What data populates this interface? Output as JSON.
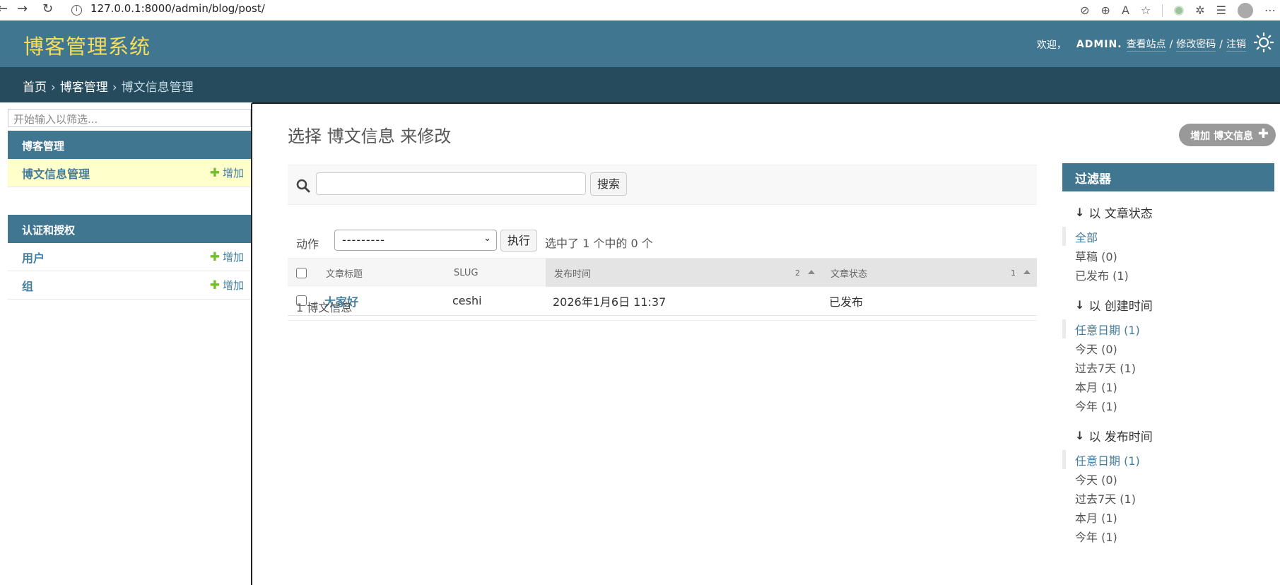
{
  "browser": {
    "url": "127.0.0.1:8000/admin/blog/post/"
  },
  "header": {
    "brand": "博客管理系统",
    "welcome": "欢迎，",
    "username": "ADMIN.",
    "view_site": "查看站点",
    "change_password": "修改密码",
    "logout": "注销",
    "separator": "/"
  },
  "breadcrumbs": {
    "home": "首页",
    "app": "博客管理",
    "current": "博文信息管理",
    "sep": "›"
  },
  "sidebar": {
    "filter_placeholder": "开始输入以筛选...",
    "modules": [
      {
        "caption": "博客管理",
        "items": [
          {
            "label": "博文信息管理",
            "add": "增加",
            "current": true
          }
        ]
      },
      {
        "caption": "认证和授权",
        "items": [
          {
            "label": "用户",
            "add": "增加",
            "current": false
          },
          {
            "label": "组",
            "add": "增加",
            "current": false
          }
        ]
      }
    ]
  },
  "main": {
    "title": "选择 博文信息 来修改",
    "add_button": "增加 博文信息",
    "search_button": "搜索",
    "actions_label": "动作",
    "actions_select_value": "---------",
    "go_button": "执行",
    "action_counter": "选中了 1 个中的 0 个",
    "table": {
      "columns": [
        {
          "label": "文章标题",
          "sort_priority": ""
        },
        {
          "label": "SLUG",
          "sort_priority": ""
        },
        {
          "label": "发布时间",
          "sort_priority": "2"
        },
        {
          "label": "文章状态",
          "sort_priority": "1"
        }
      ],
      "rows": [
        {
          "title": "大家好",
          "slug": "ceshi",
          "publish": "2026年1月6日 11:37",
          "status": "已发布"
        }
      ]
    },
    "paginator": "1 博文信息"
  },
  "filter": {
    "caption": "过滤器",
    "groups": [
      {
        "title": "以 文章状态",
        "items": [
          {
            "label": "全部",
            "selected": true
          },
          {
            "label": "草稿 (0)",
            "selected": false
          },
          {
            "label": "已发布 (1)",
            "selected": false
          }
        ]
      },
      {
        "title": "以 创建时间",
        "items": [
          {
            "label": "任意日期 (1)",
            "selected": true
          },
          {
            "label": "今天 (0)",
            "selected": false
          },
          {
            "label": "过去7天 (1)",
            "selected": false
          },
          {
            "label": "本月 (1)",
            "selected": false
          },
          {
            "label": "今年 (1)",
            "selected": false
          }
        ]
      },
      {
        "title": "以 发布时间",
        "items": [
          {
            "label": "任意日期 (1)",
            "selected": true
          },
          {
            "label": "今天 (0)",
            "selected": false
          },
          {
            "label": "过去7天 (1)",
            "selected": false
          },
          {
            "label": "本月 (1)",
            "selected": false
          },
          {
            "label": "今年 (1)",
            "selected": false
          }
        ]
      }
    ]
  },
  "colors": {
    "header_bg": "#417690",
    "breadcrumb_bg": "#264b5d",
    "brand_text": "#f5dd5d",
    "link": "#447e9b",
    "add_plus": "#70bf2b",
    "current_row": "#ffffcc"
  }
}
